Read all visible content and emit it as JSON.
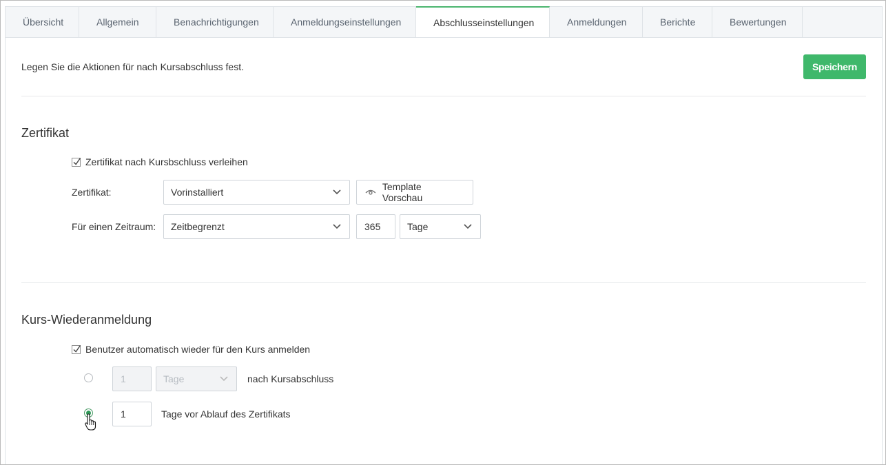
{
  "tabs": [
    {
      "label": "Übersicht"
    },
    {
      "label": "Allgemein"
    },
    {
      "label": "Benachrichtigungen"
    },
    {
      "label": "Anmeldungseinstellungen"
    },
    {
      "label": "Abschlusseinstellungen",
      "active": true
    },
    {
      "label": "Anmeldungen"
    },
    {
      "label": "Berichte"
    },
    {
      "label": "Bewertungen"
    }
  ],
  "header": {
    "intro": "Legen Sie die Aktionen für nach Kursabschluss fest.",
    "save_label": "Speichern"
  },
  "certificate": {
    "title": "Zertifikat",
    "award_checkbox_label": "Zertifikat nach Kursbschluss verleihen",
    "award_checked": true,
    "certificate_label": "Zertifikat:",
    "certificate_value": "Vorinstalliert",
    "preview_label": "Template Vorschau",
    "period_label": "Für einen Zeitraum:",
    "period_value": "Zeitbegrenzt",
    "duration_amount": "365",
    "duration_unit": "Tage"
  },
  "reenrollment": {
    "title": "Kurs-Wiederanmeldung",
    "auto_checkbox_label": "Benutzer automatisch wieder für den Kurs anmelden",
    "auto_checked": true,
    "option1_amount": "1",
    "option1_unit": "Tage",
    "option1_suffix": "nach Kursabschluss",
    "option1_selected": false,
    "option2_amount": "1",
    "option2_suffix": "Tage vor Ablauf des Zertifikats",
    "option2_selected": true
  },
  "colors": {
    "accent": "#3fb86b",
    "active_tab_border": "#4bb56f"
  }
}
